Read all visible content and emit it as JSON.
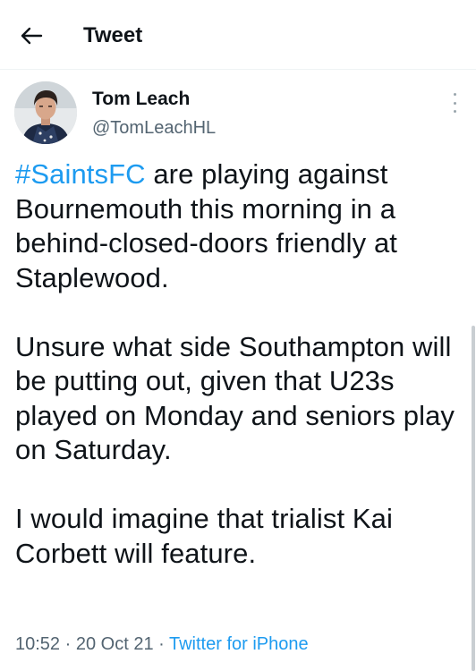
{
  "header": {
    "title": "Tweet"
  },
  "author": {
    "name": "Tom Leach",
    "handle": "@TomLeachHL"
  },
  "tweet": {
    "hashtag": "#SaintsFC",
    "line1_rest": " are playing against Bournemouth this morning in a behind-closed-doors friendly at Staplewood.",
    "paragraph2": "Unsure what side Southampton will be putting out, given that U23s played on Monday and seniors play on Saturday.",
    "paragraph3": "I would imagine that trialist Kai Corbett will feature."
  },
  "meta": {
    "time": "10:52",
    "separator": " · ",
    "date": "20 Oct 21",
    "source": "Twitter for iPhone"
  },
  "colors": {
    "link": "#1d9bf0",
    "secondary_text": "#536471",
    "text": "#0f1419"
  }
}
